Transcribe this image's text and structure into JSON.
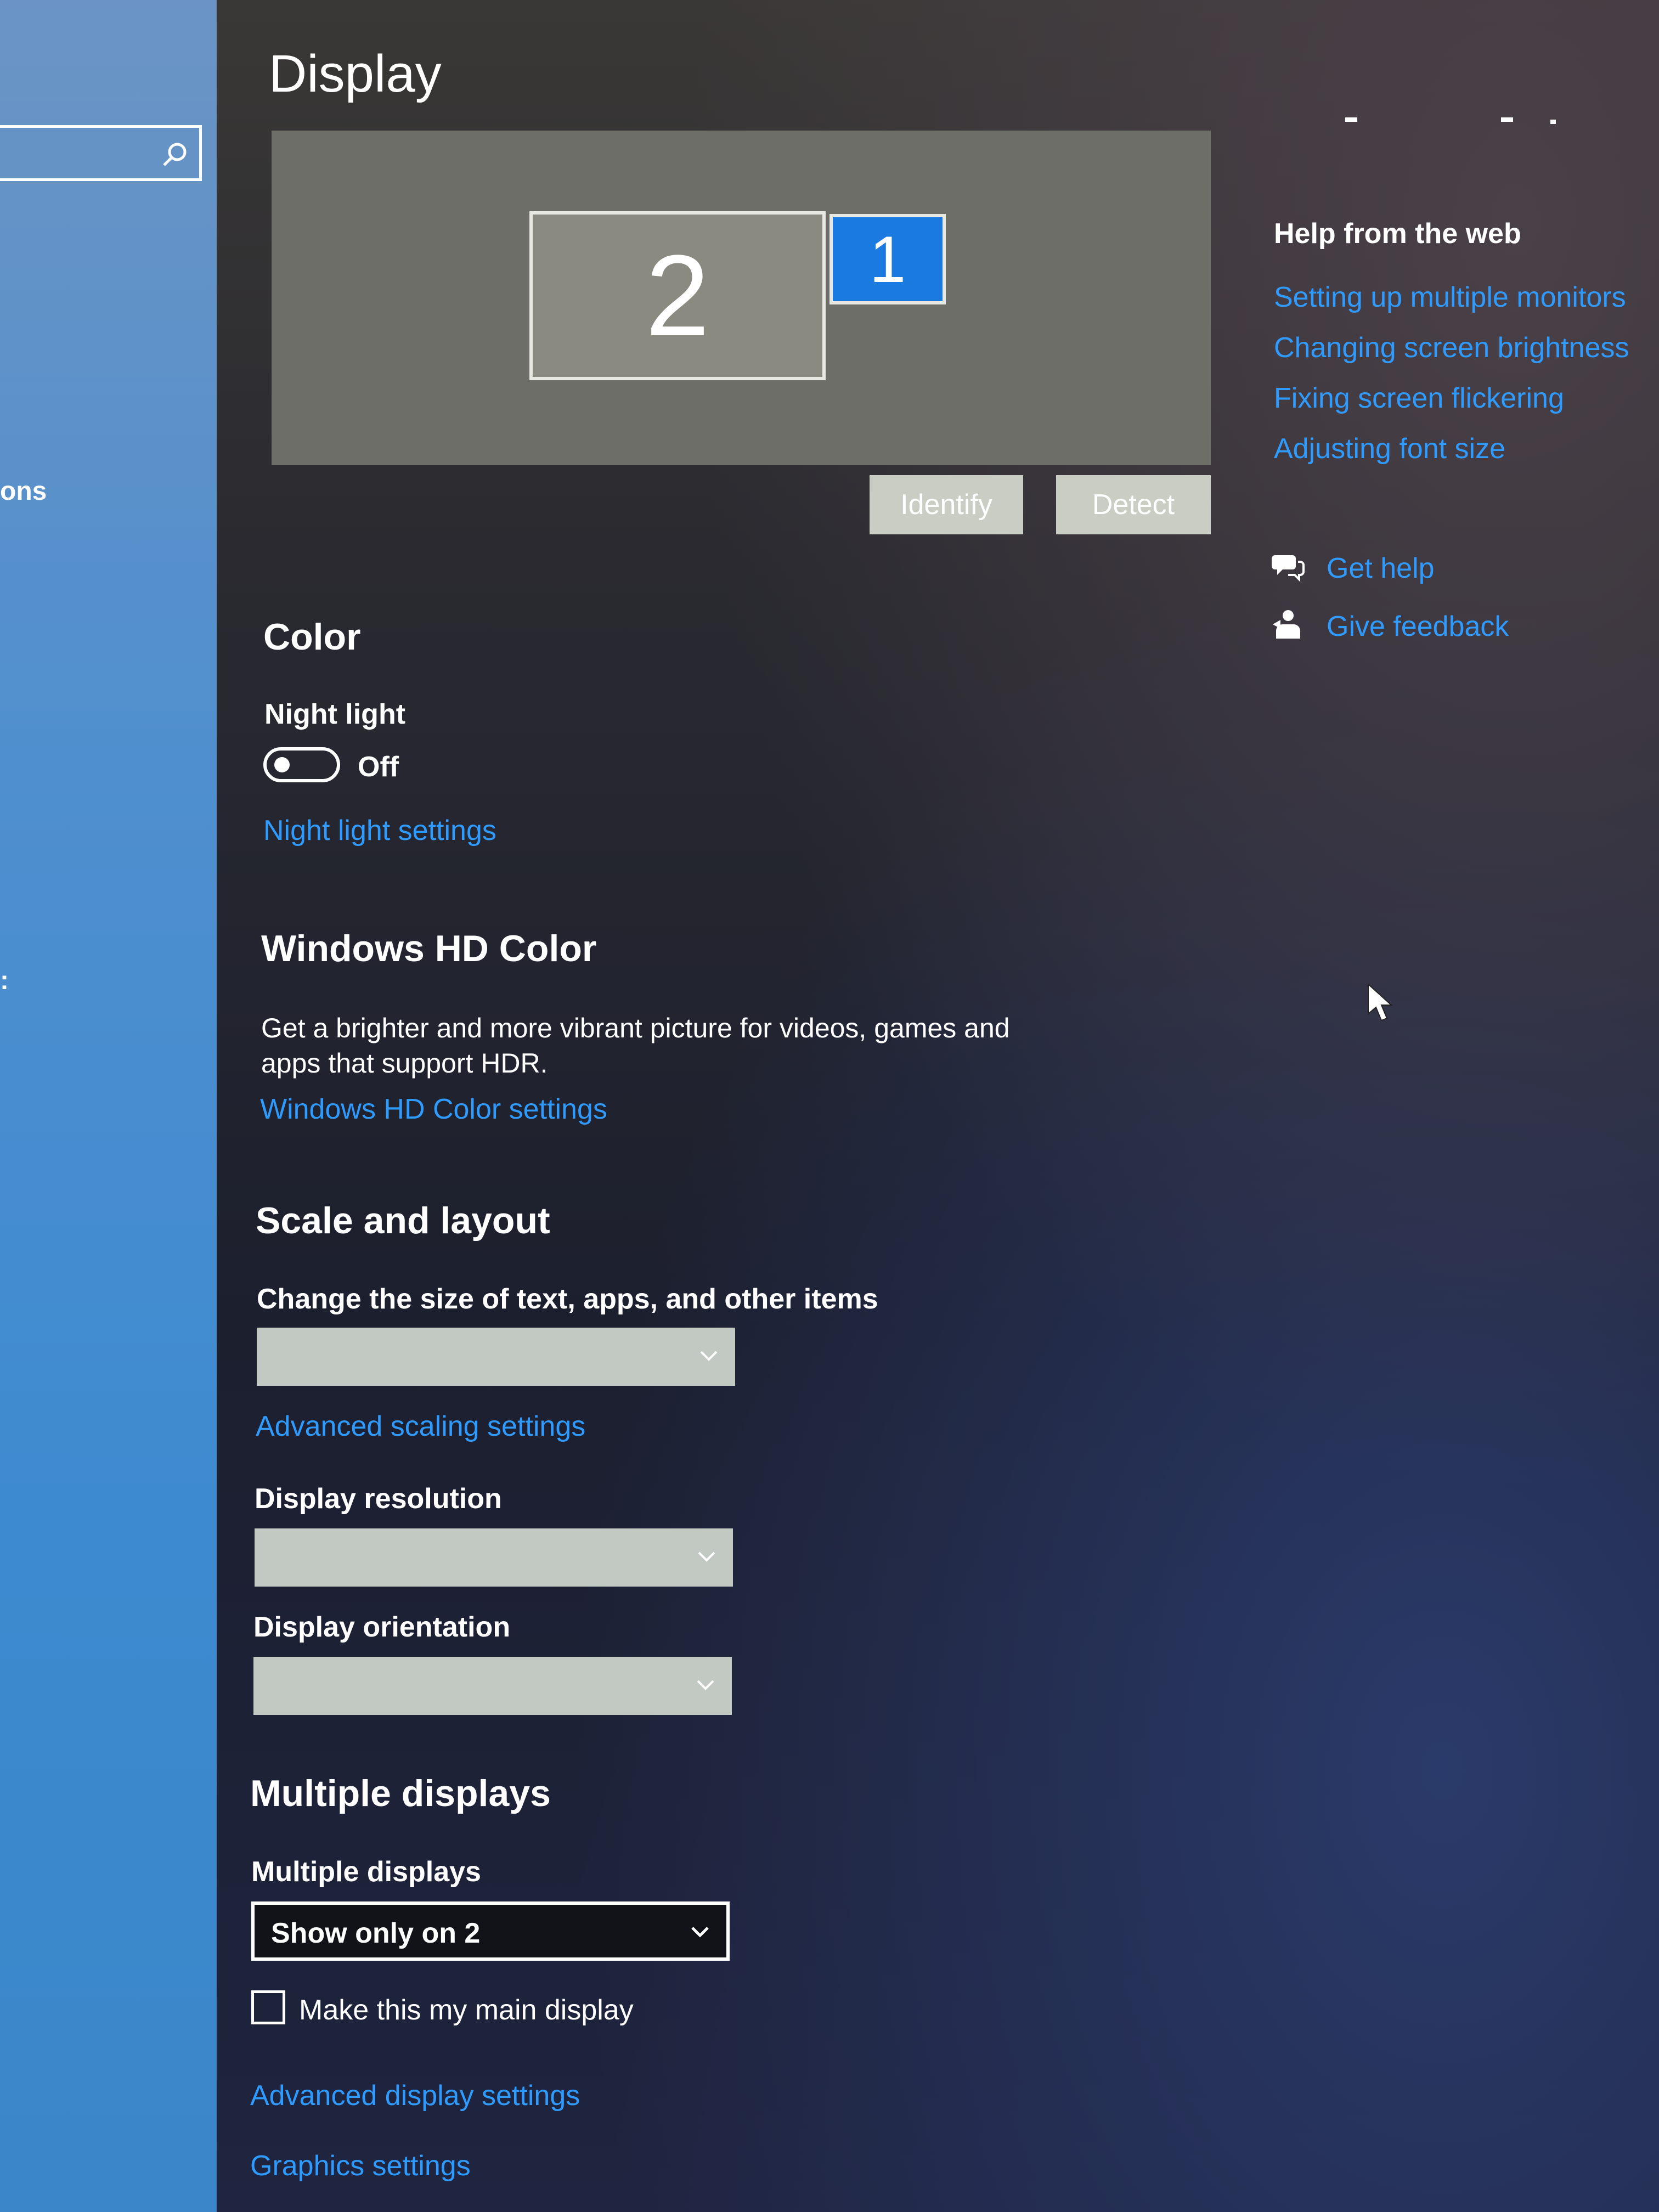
{
  "sidebar": {
    "search_placeholder": "",
    "partial_item_1": "ons",
    "partial_item_2": ":"
  },
  "header": {
    "title": "Display"
  },
  "arrangement": {
    "monitor_secondary": "2",
    "monitor_primary": "1",
    "identify_label": "Identify",
    "detect_label": "Detect"
  },
  "color": {
    "heading": "Color",
    "night_light_label": "Night light",
    "night_light_state": "Off",
    "night_light_settings_link": "Night light settings"
  },
  "hdr": {
    "heading": "Windows HD Color",
    "description": "Get a brighter and more vibrant picture for videos, games and apps that support HDR.",
    "settings_link": "Windows HD Color settings"
  },
  "scale": {
    "heading": "Scale and layout",
    "size_label": "Change the size of text, apps, and other items",
    "advanced_link": "Advanced scaling settings",
    "resolution_label": "Display resolution",
    "orientation_label": "Display orientation"
  },
  "multiple": {
    "heading": "Multiple displays",
    "label": "Multiple displays",
    "selected": "Show only on 2",
    "main_display_checkbox": "Make this my main display",
    "advanced_display_link": "Advanced display settings",
    "graphics_link": "Graphics settings"
  },
  "help": {
    "title": "Help from the web",
    "links": [
      "Setting up multiple monitors",
      "Changing screen brightness",
      "Fixing screen flickering",
      "Adjusting font size"
    ],
    "get_help": "Get help",
    "give_feedback": "Give feedback"
  },
  "colors": {
    "accent": "#2f9bff",
    "primary_monitor": "#1a7ae0"
  }
}
